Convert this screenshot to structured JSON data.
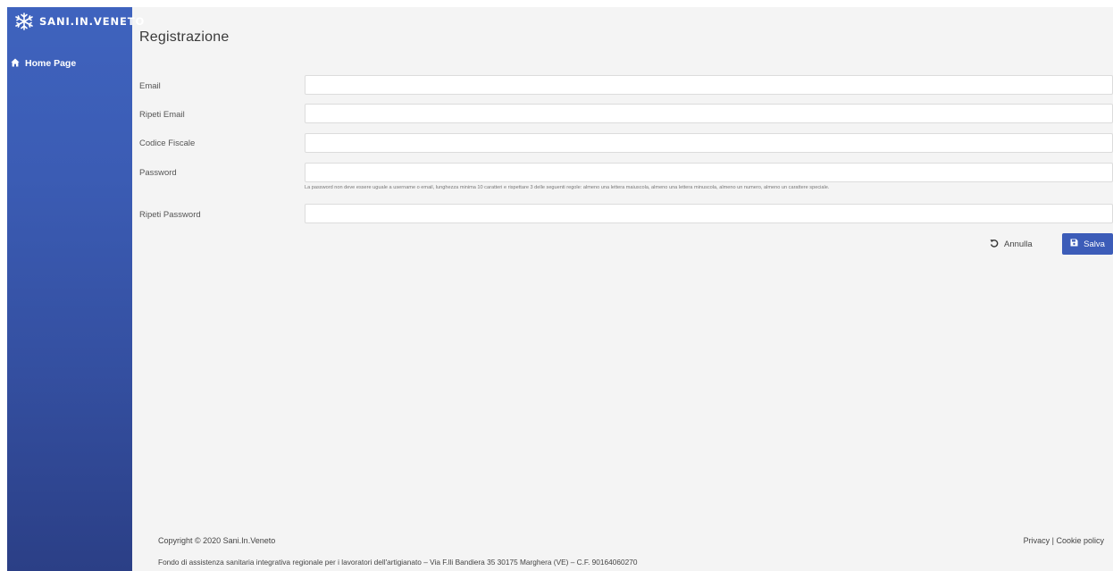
{
  "brand": {
    "name": "SANI.IN.VENETO",
    "logo_icon": "snowflake-logo-icon"
  },
  "sidebar": {
    "items": [
      {
        "label": "Home Page",
        "icon": "home-icon"
      }
    ]
  },
  "page": {
    "title": "Registrazione"
  },
  "form": {
    "email": {
      "label": "Email",
      "value": ""
    },
    "repeat_email": {
      "label": "Ripeti Email",
      "value": ""
    },
    "tax_code": {
      "label": "Codice Fiscale",
      "value": ""
    },
    "password": {
      "label": "Password",
      "value": "",
      "help": "La password non deve essere uguale a username o email, lunghezza minima 10 caratteri e rispettare 3 delle seguenti regole: almeno una lettera maiuscola, almeno una lettera minuscola, almeno un numero, almeno un carattere speciale."
    },
    "repeat_password": {
      "label": "Ripeti Password",
      "value": ""
    }
  },
  "actions": {
    "cancel_label": "Annulla",
    "cancel_icon": "undo-icon",
    "save_label": "Salva",
    "save_icon": "floppy-disk-icon"
  },
  "footer": {
    "copyright": "Copyright © 2020 Sani.In.Veneto",
    "privacy": "Privacy",
    "separator": "|",
    "cookie": "Cookie policy",
    "info": "Fondo di assistenza sanitaria integrativa regionale per i lavoratori dell'artigianato – Via F.lli Bandiera 35 30175 Marghera (VE) – C.F. 90164060270"
  },
  "colors": {
    "sidebar_top": "#3f63be",
    "sidebar_bottom": "#2b3f86",
    "primary": "#3c5cb8",
    "background": "#f4f4f4"
  }
}
